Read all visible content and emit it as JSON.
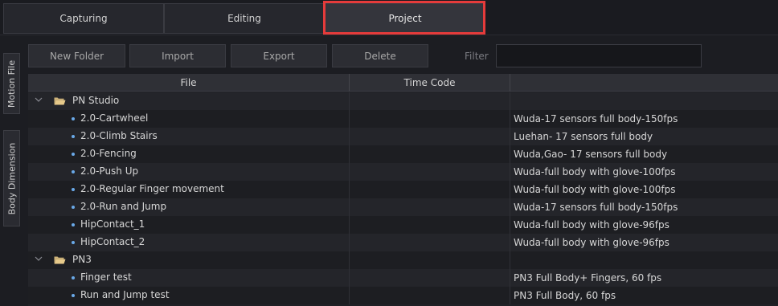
{
  "tabs": [
    {
      "label": "Capturing"
    },
    {
      "label": "Editing"
    },
    {
      "label": "Project"
    }
  ],
  "side_tabs": [
    {
      "label": "Motion File"
    },
    {
      "label": "Body Dimension"
    }
  ],
  "toolbar": {
    "new_folder": "New Folder",
    "import": "Import",
    "export": "Export",
    "delete": "Delete",
    "filter_label": "Filter",
    "filter_value": ""
  },
  "table": {
    "columns": [
      "File",
      "Time Code",
      ""
    ],
    "groups": [
      {
        "folder": "PN Studio",
        "files": [
          {
            "name": "2.0-Cartwheel",
            "timecode": "",
            "note": "Wuda-17 sensors full body-150fps"
          },
          {
            "name": "2.0-Climb Stairs",
            "timecode": "",
            "note": "Luehan- 17 sensors full body"
          },
          {
            "name": "2.0-Fencing",
            "timecode": "",
            "note": "Wuda,Gao- 17 sensors full body"
          },
          {
            "name": "2.0-Push Up",
            "timecode": "",
            "note": "Wuda-full body with glove-100fps"
          },
          {
            "name": "2.0-Regular Finger movement",
            "timecode": "",
            "note": "Wuda-full body with glove-100fps"
          },
          {
            "name": "2.0-Run and Jump",
            "timecode": "",
            "note": "Wuda-17 sensors full body-150fps"
          },
          {
            "name": "HipContact_1",
            "timecode": "",
            "note": "Wuda-full body with glove-96fps"
          },
          {
            "name": "HipContact_2",
            "timecode": "",
            "note": "Wuda-full body with glove-96fps"
          }
        ]
      },
      {
        "folder": "PN3",
        "files": [
          {
            "name": "Finger test",
            "timecode": "",
            "note": "PN3 Full Body+ Fingers, 60 fps"
          },
          {
            "name": "Run and Jump test",
            "timecode": "",
            "note": "PN3 Full Body, 60 fps"
          }
        ]
      }
    ]
  },
  "colors": {
    "highlight": "#e53b3b",
    "bullet": "#6aa9e8",
    "folder": "#e6c98a"
  }
}
